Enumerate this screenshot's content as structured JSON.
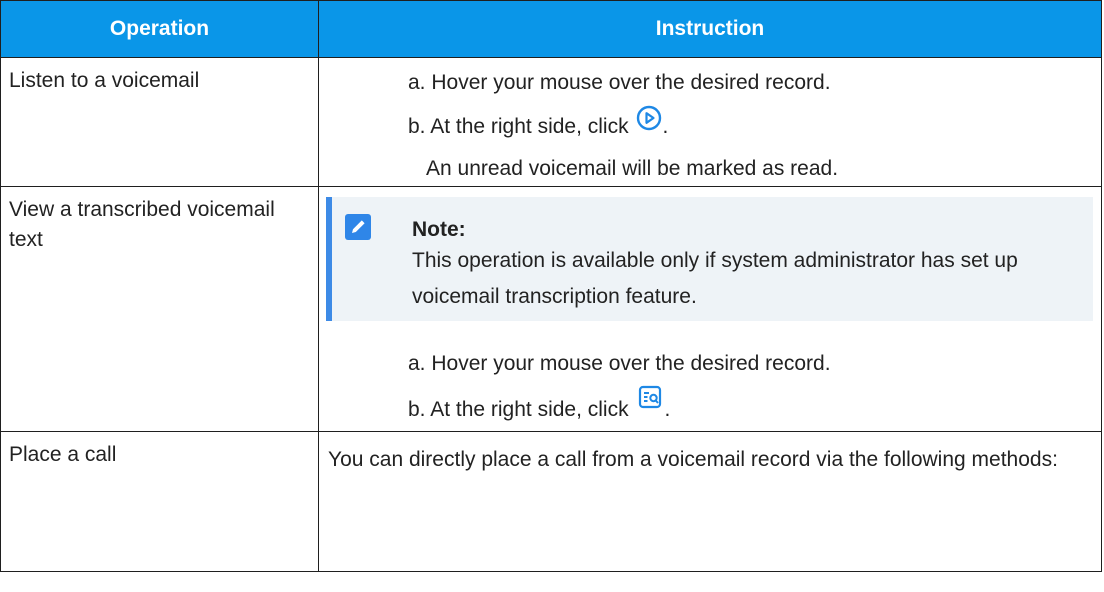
{
  "table": {
    "headers": {
      "operation": "Operation",
      "instruction": "Instruction"
    },
    "rows": [
      {
        "operation": "Listen to a voicemail",
        "step_a": "a. Hover your mouse over the desired record.",
        "step_b": "b. At the right side, click",
        "step_b_icon": "play-circle-icon",
        "step_b_end": ".",
        "result": "An unread voicemail will be marked as read."
      },
      {
        "operation": "View a transcribed voicemail text",
        "note": {
          "icon": "edit-note-icon",
          "title": "Note:",
          "body": "This operation is available only if system administrator has set up voicemail transcription feature."
        },
        "step_a": "a. Hover your mouse over the desired record.",
        "step_b": "b. At the right side, click",
        "step_b_icon": "transcript-search-icon",
        "step_b_end": "."
      },
      {
        "operation": "Place a call",
        "instruction": "You can directly place a call from a voicemail record via the following methods:"
      }
    ]
  },
  "colors": {
    "header_bg": "#0a96e8",
    "note_bg": "#eef3f7",
    "note_bar": "#3d8ae6",
    "icon": "#1e88e5"
  }
}
